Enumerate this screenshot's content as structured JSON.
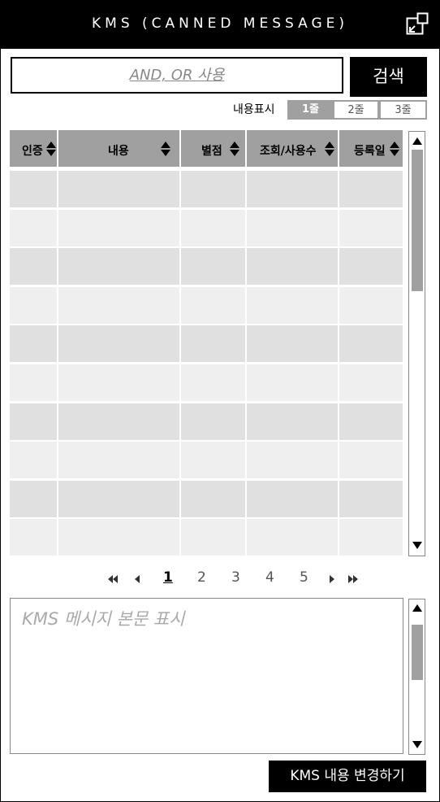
{
  "window": {
    "title": "KMS (CANNED MESSAGE)"
  },
  "search": {
    "placeholder": "AND, OR 사용",
    "button_label": "검색"
  },
  "display_options": {
    "label": "내용표시",
    "options": [
      "1줄",
      "2줄",
      "3줄"
    ],
    "selected": "1줄"
  },
  "table": {
    "columns": [
      "인증",
      "내용",
      "별점",
      "조회/사용수",
      "등록일"
    ],
    "row_count": 10
  },
  "pagination": {
    "first": "«",
    "prev": "‹",
    "pages": [
      "1",
      "2",
      "3",
      "4",
      "5"
    ],
    "current": "1",
    "next": "›",
    "last": "»"
  },
  "message": {
    "placeholder": "KMS 메시지 본문 표시"
  },
  "actions": {
    "change_label": "KMS 내용 변경하기"
  },
  "colors": {
    "titlebar": "#000000",
    "header_gray": "#a0a0a0",
    "row_dark": "#e0e0e0",
    "row_light": "#efefef"
  }
}
